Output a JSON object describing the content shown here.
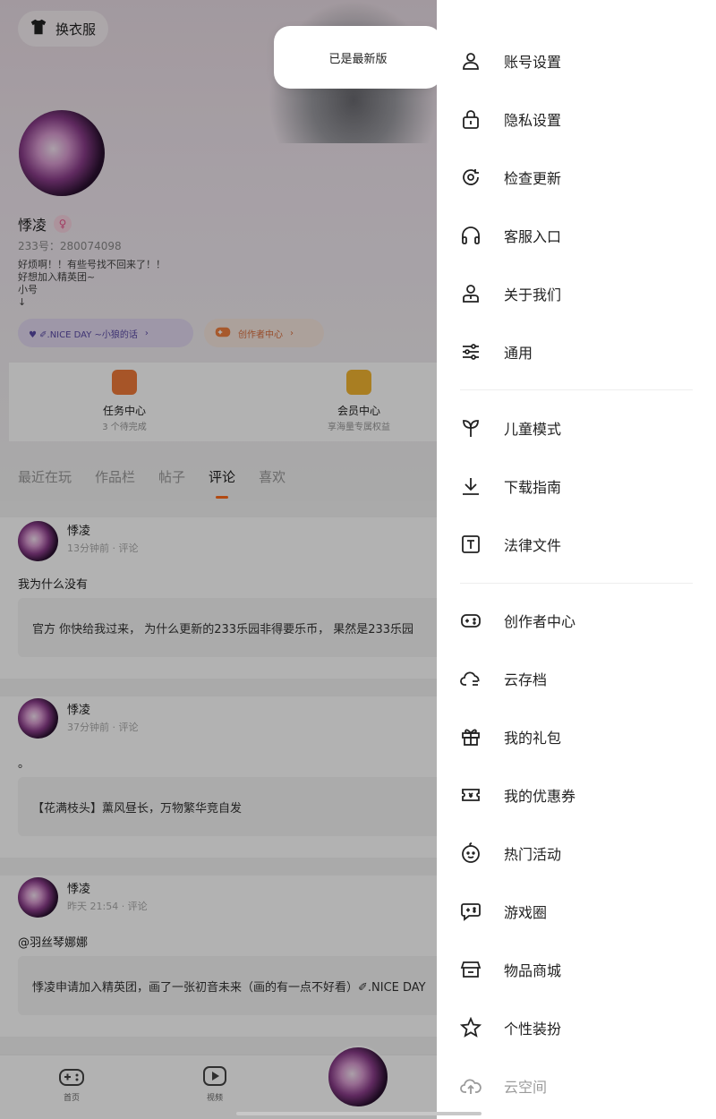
{
  "profile": {
    "outfit_button": "换衣服",
    "nickname": "悸凌",
    "gender_symbol": "♀",
    "uid": "233号：280074098",
    "bio_lines": [
      "好烦啊！！有些号找不回来了！！",
      "好想加入精英团~",
      "小号",
      "↓"
    ],
    "nice_day_pill": "♥ ✐.NICE DAY ~小狼的话",
    "creator_pill": "创作者中心",
    "cards": [
      {
        "title": "任务中心",
        "subtitle": "3 个待完成"
      },
      {
        "title": "会员中心",
        "subtitle": "享海量专属权益"
      }
    ],
    "tabs": [
      "最近在玩",
      "作品栏",
      "帖子",
      "评论",
      "喜欢"
    ],
    "active_tab": "评论",
    "posts": [
      {
        "author": "悸凌",
        "time": "13分钟前 · 评论",
        "comment": "我为什么没有",
        "quote": "官方 你快给我过来， 为什么更新的233乐园非得要乐币， 果然是233乐园"
      },
      {
        "author": "悸凌",
        "time": "37分钟前 · 评论",
        "comment": "。",
        "quote": "【花满枝头】薰风昼长，万物繁华竞自发"
      },
      {
        "author": "悸凌",
        "time": "昨天 21:54 · 评论",
        "comment": "@羽丝琴娜娜",
        "quote": "悸凌申请加入精英团，画了一张初音未来（画的有一点不好看）✐.NICE DAY"
      }
    ],
    "bottom_nav": [
      {
        "label": "首页",
        "icon": "gamepad-icon"
      },
      {
        "label": "视频",
        "icon": "video-icon"
      }
    ]
  },
  "toast": {
    "text": "已是最新版"
  },
  "drawer": {
    "items": [
      {
        "label": "账号设置",
        "icon": "user-icon"
      },
      {
        "label": "隐私设置",
        "icon": "lock-icon"
      },
      {
        "label": "检查更新",
        "icon": "refresh-icon"
      },
      {
        "label": "客服入口",
        "icon": "headphones-icon"
      },
      {
        "label": "关于我们",
        "icon": "person-badge-icon"
      },
      {
        "label": "通用",
        "icon": "sliders-icon"
      },
      {
        "label": "儿童模式",
        "icon": "sprout-icon"
      },
      {
        "label": "下载指南",
        "icon": "download-icon"
      },
      {
        "label": "法律文件",
        "icon": "document-t-icon"
      },
      {
        "label": "创作者中心",
        "icon": "gamepad-icon"
      },
      {
        "label": "云存档",
        "icon": "cloud-save-icon"
      },
      {
        "label": "我的礼包",
        "icon": "gift-icon"
      },
      {
        "label": "我的优惠券",
        "icon": "ticket-icon"
      },
      {
        "label": "热门活动",
        "icon": "smiley-icon"
      },
      {
        "label": "游戏圈",
        "icon": "game-chat-icon"
      },
      {
        "label": "物品商城",
        "icon": "store-icon"
      },
      {
        "label": "个性装扮",
        "icon": "star-icon"
      },
      {
        "label": "云空间",
        "icon": "cloud-upload-icon"
      }
    ]
  },
  "colors": {
    "accent": "#ff6a1a",
    "drawer_bg": "#ffffff",
    "overlay": "rgba(0,0,0,0.30)"
  }
}
